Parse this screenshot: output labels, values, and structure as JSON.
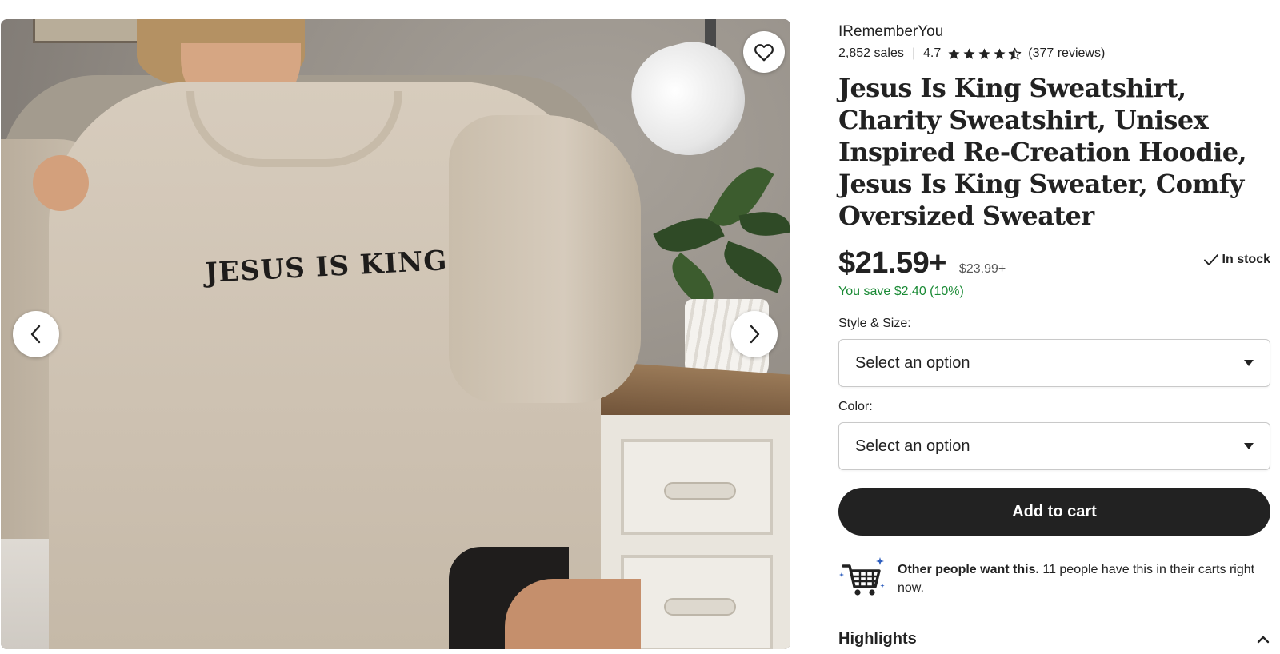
{
  "shop": {
    "name": "IRememberYou",
    "sales": "2,852 sales",
    "rating": "4.7",
    "rating_value": 4.7,
    "reviews": "(377 reviews)"
  },
  "product": {
    "title": "Jesus Is King Sweatshirt, Charity Sweatshirt, Unisex Inspired Re-Creation Hoodie, Jesus Is King Sweater, Comfy Oversized Sweater",
    "print_text": "JESUS IS KING",
    "price": "$21.59+",
    "original_price": "$23.99+",
    "savings": "You save $2.40 (10%)",
    "stock": "In stock"
  },
  "options": {
    "style_label": "Style & Size:",
    "style_value": "Select an option",
    "color_label": "Color:",
    "color_value": "Select an option"
  },
  "actions": {
    "add_to_cart": "Add to cart"
  },
  "social_proof": {
    "bold": "Other people want this.",
    "rest": " 11 people have this in their carts right now."
  },
  "sections": {
    "highlights": "Highlights"
  },
  "icons": {
    "favorite": "heart-icon",
    "prev": "chevron-left-icon",
    "next": "chevron-right-icon",
    "star": "star-icon",
    "stock": "check-icon",
    "cart": "shopping-cart-icon",
    "collapse": "chevron-up-icon",
    "dropdown": "caret-down-icon"
  },
  "colors": {
    "text": "#222222",
    "savings": "#1a8a35",
    "button": "#222222",
    "border": "#c9c9c9"
  }
}
